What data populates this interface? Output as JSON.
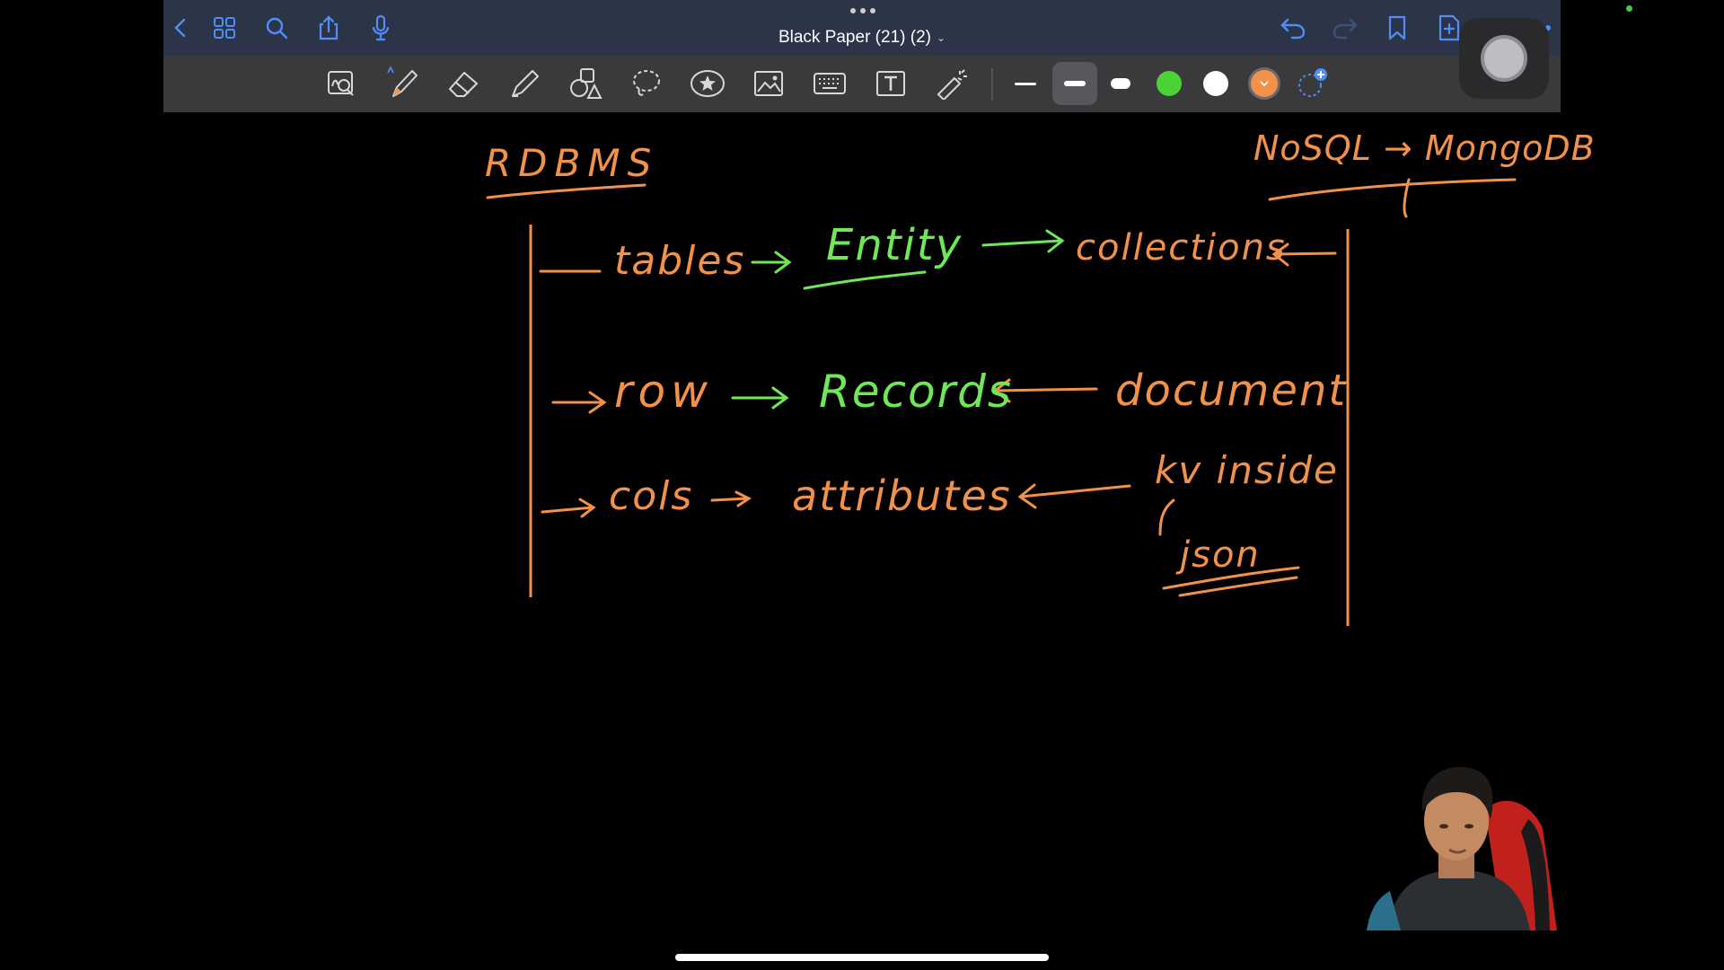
{
  "app": {
    "title": "Black Paper  (21) (2)",
    "title_chevron": "⌄"
  },
  "colors": {
    "topbar": "#2c3447",
    "toolbar": "#3a3a3c",
    "accent_blue": "#4f8ef7",
    "ink_orange": "#f2914a",
    "ink_green": "#6ee857",
    "swatch_green": "#4cd137",
    "swatch_white": "#ffffff",
    "swatch_orange": "#f2914a"
  },
  "top_bar": {
    "left_icons": [
      "back-icon",
      "grid-icon",
      "search-icon",
      "share-icon",
      "microphone-icon"
    ],
    "right_icons": [
      "undo-icon",
      "redo-icon",
      "bookmark-icon",
      "add-page-icon",
      "close-icon",
      "more-icon"
    ]
  },
  "toolbar": {
    "tools": [
      "zoom-tool-icon",
      "pen-tool-icon",
      "eraser-tool-icon",
      "highlighter-tool-icon",
      "shapes-tool-icon",
      "lasso-tool-icon",
      "sticker-tool-icon",
      "image-tool-icon",
      "keyboard-tool-icon",
      "text-tool-icon",
      "laser-pointer-icon"
    ],
    "active_tool": "pen-tool-icon",
    "stroke_widths": [
      "thin",
      "medium",
      "thick"
    ],
    "selected_stroke": "medium",
    "color_swatches": [
      "green",
      "white",
      "orange"
    ],
    "selected_color": "orange"
  },
  "notes": {
    "left_heading": "RDBMS",
    "right_heading": "NoSQL → MongoDB",
    "row1": {
      "left": "tables",
      "middle": "Entity",
      "right": "collections"
    },
    "row2": {
      "left": "row",
      "middle": "Records",
      "right": "document"
    },
    "row3": {
      "left": "cols",
      "middle": "attributes",
      "right": "kv inside",
      "right_sub": "json"
    }
  }
}
